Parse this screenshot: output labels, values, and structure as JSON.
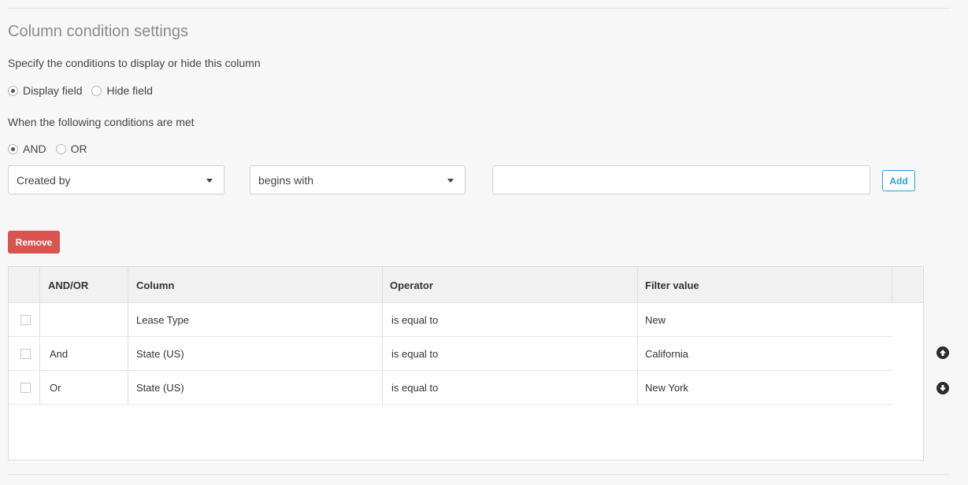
{
  "section": {
    "title": "Column condition settings",
    "instruction": "Specify the conditions to display or hide this column"
  },
  "visibility": {
    "options": [
      {
        "label": "Display field",
        "checked": true
      },
      {
        "label": "Hide field",
        "checked": false
      }
    ]
  },
  "conditions": {
    "label": "When the following conditions are met",
    "logic_options": [
      {
        "label": "AND",
        "checked": true
      },
      {
        "label": "OR",
        "checked": false
      }
    ]
  },
  "filter_builder": {
    "column_select": "Created by",
    "operator_select": "begins with",
    "value_input": "",
    "add_label": "Add"
  },
  "actions": {
    "remove_label": "Remove"
  },
  "grid": {
    "headers": [
      "AND/OR",
      "Column",
      "Operator",
      "Filter value"
    ],
    "rows": [
      {
        "logic": "",
        "column": "Lease Type",
        "operator": "is equal to",
        "value": "New"
      },
      {
        "logic": "And",
        "column": "State (US)",
        "operator": "is equal to",
        "value": "California"
      },
      {
        "logic": "Or",
        "column": "State (US)",
        "operator": "is equal to",
        "value": "New York"
      }
    ]
  },
  "colors": {
    "accent": "#2a9fd6",
    "danger": "#d9534f"
  },
  "icons": {
    "move_up": "arrow-circle-up-icon",
    "move_down": "arrow-circle-down-icon"
  }
}
